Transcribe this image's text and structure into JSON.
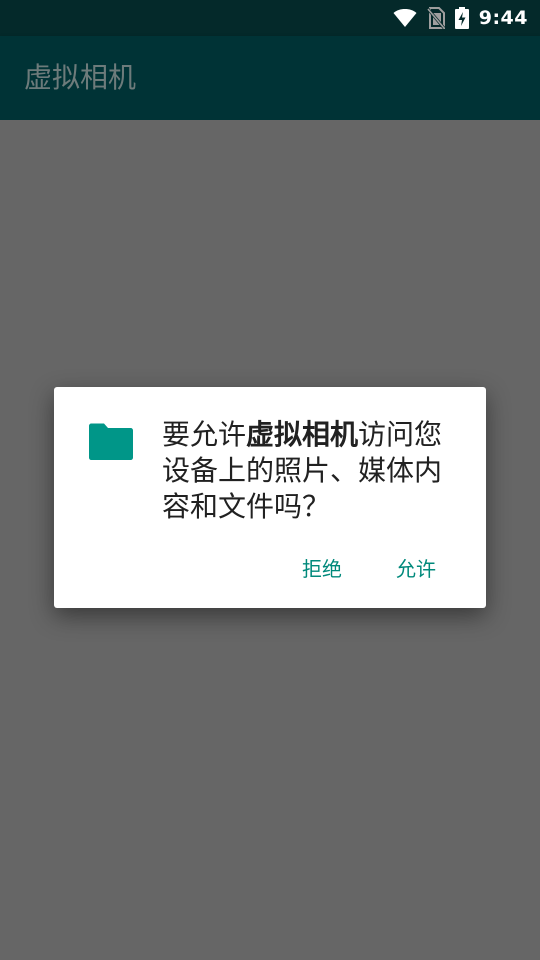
{
  "status_bar": {
    "time": "9:44",
    "icons": [
      "wifi-icon",
      "no-sim-icon",
      "battery-charging-icon"
    ]
  },
  "app_bar": {
    "title": "虚拟相机"
  },
  "dialog": {
    "icon": "folder-icon",
    "message_prefix": "要允许",
    "app_name": "虚拟相机",
    "message_suffix": "访问您设备上的照片、媒体内容和文件吗？",
    "deny_label": "拒绝",
    "allow_label": "允许"
  },
  "colors": {
    "status_bar": "#04292a",
    "app_bar": "#003336",
    "scrim_background": "#666666",
    "accent": "#00897b",
    "dialog_background": "#ffffff"
  }
}
